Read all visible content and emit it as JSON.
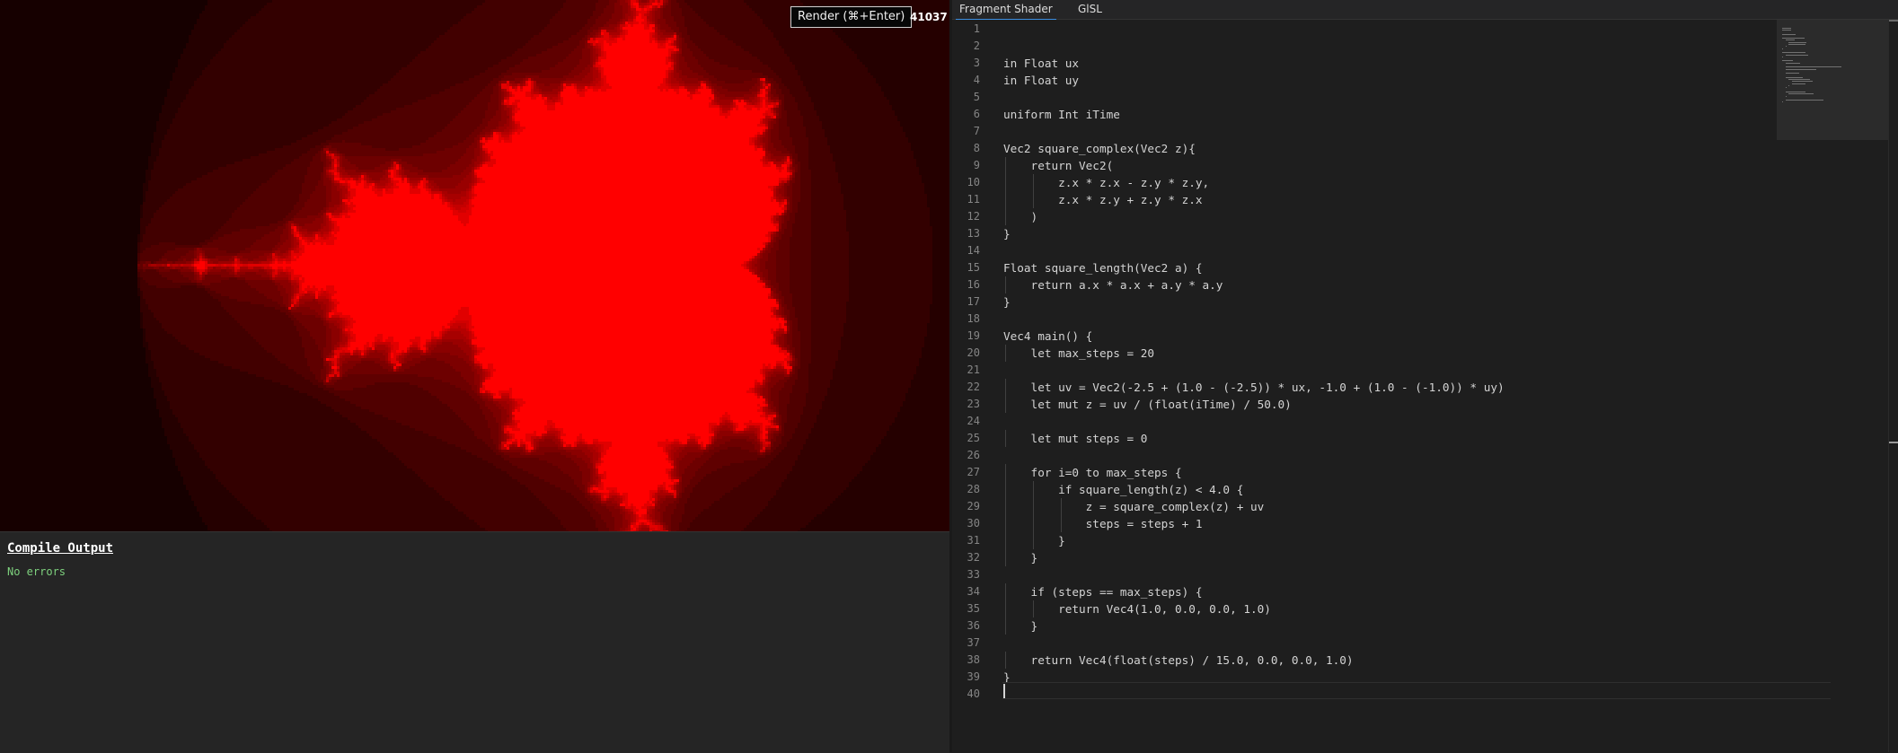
{
  "render_button": {
    "label": "Render (⌘+Enter)"
  },
  "frame_counter": "41037",
  "compile": {
    "title": "Compile Output",
    "status": "No errors"
  },
  "tabs": [
    {
      "label": "Fragment Shader",
      "active": true
    },
    {
      "label": "GlSL",
      "active": false
    }
  ],
  "colors": {
    "fractal_red": "#ff0000",
    "background": "#1e1e1e",
    "status_ok": "#7ed17e",
    "accent": "#3c8ee0"
  },
  "code": {
    "lines": [
      "",
      "",
      "in Float ux",
      "in Float uy",
      "",
      "uniform Int iTime",
      "",
      "Vec2 square_complex(Vec2 z){",
      "    return Vec2(",
      "        z.x * z.x - z.y * z.y,",
      "        z.x * z.y + z.y * z.x",
      "    )",
      "}",
      "",
      "Float square_length(Vec2 a) {",
      "    return a.x * a.x + a.y * a.y",
      "}",
      "",
      "Vec4 main() {",
      "    let max_steps = 20",
      "",
      "    let uv = Vec2(-2.5 + (1.0 - (-2.5)) * ux, -1.0 + (1.0 - (-1.0)) * uy)",
      "    let mut z = uv / (float(iTime) / 50.0)",
      "",
      "    let mut steps = 0",
      "",
      "    for i=0 to max_steps {",
      "        if square_length(z) < 4.0 {",
      "            z = square_complex(z) + uv",
      "            steps = steps + 1",
      "        }",
      "    }",
      "",
      "    if (steps == max_steps) {",
      "        return Vec4(1.0, 0.0, 0.0, 1.0)",
      "    }",
      "",
      "    return Vec4(float(steps) / 15.0, 0.0, 0.0, 1.0)",
      "}",
      ""
    ],
    "line_numbers": [
      "1",
      "2",
      "3",
      "4",
      "5",
      "6",
      "7",
      "8",
      "9",
      "10",
      "11",
      "12",
      "13",
      "14",
      "15",
      "16",
      "17",
      "18",
      "19",
      "20",
      "21",
      "22",
      "23",
      "24",
      "25",
      "26",
      "27",
      "28",
      "29",
      "30",
      "31",
      "32",
      "33",
      "34",
      "35",
      "36",
      "37",
      "38",
      "39",
      "40"
    ]
  }
}
